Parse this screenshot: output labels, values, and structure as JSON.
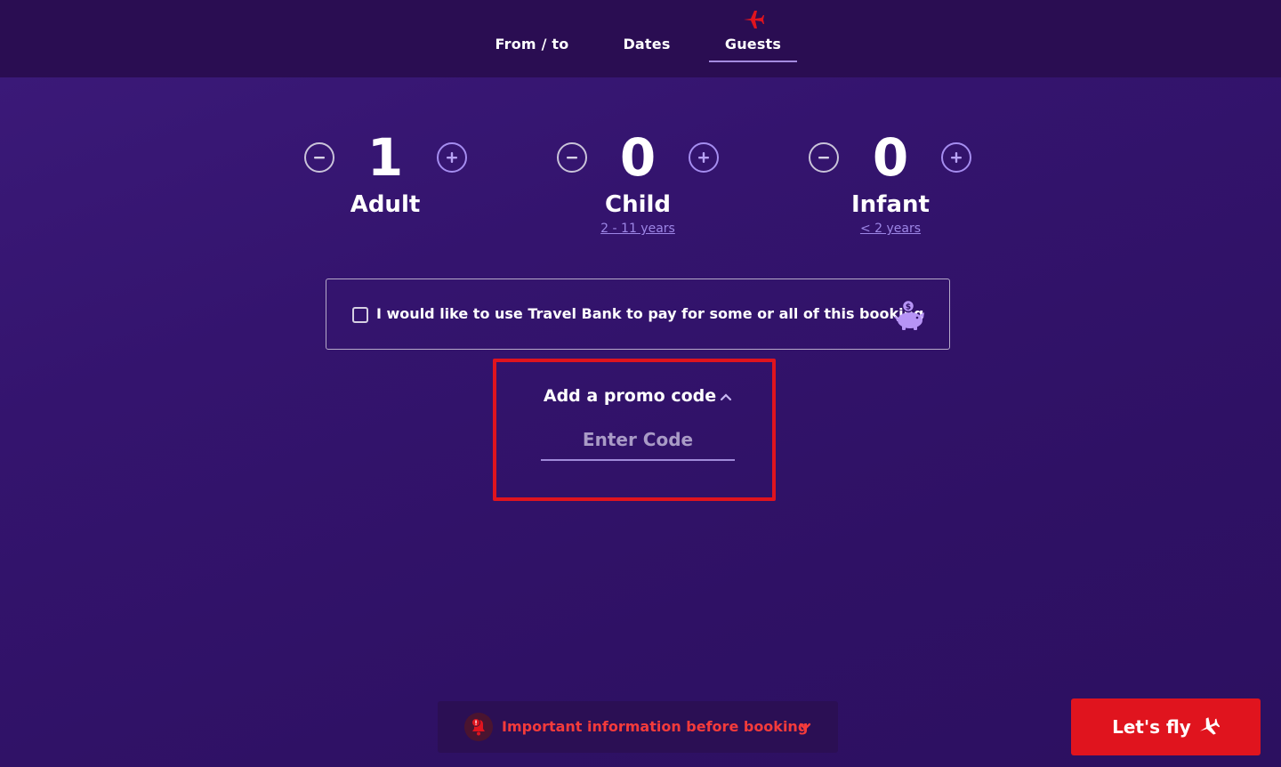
{
  "nav": {
    "tabs": [
      {
        "label": "From / to",
        "active": false
      },
      {
        "label": "Dates",
        "active": false
      },
      {
        "label": "Guests",
        "active": true
      }
    ],
    "accent": "#e0141e"
  },
  "guests": {
    "adult": {
      "count": "1",
      "label": "Adult",
      "sublabel": ""
    },
    "child": {
      "count": "0",
      "label": "Child",
      "sublabel": "2 - 11 years"
    },
    "infant": {
      "count": "0",
      "label": "Infant",
      "sublabel": "< 2 years"
    }
  },
  "travel_bank": {
    "label": "I would like to use Travel Bank to pay for some or all of this booking",
    "checked": false,
    "icon": "piggy-bank-icon"
  },
  "promo": {
    "title": "Add a promo code",
    "expanded": true,
    "input_value": "",
    "placeholder": "Enter Code"
  },
  "info_bar": {
    "label": "Important information before booking",
    "icon": "bell-alert-icon"
  },
  "cta": {
    "label": "Let's fly",
    "icon": "plane-icon"
  },
  "colors": {
    "background": "#34146e",
    "header": "#2a0d52",
    "accent_red": "#e0141e",
    "accent_purple": "#a58df0"
  }
}
